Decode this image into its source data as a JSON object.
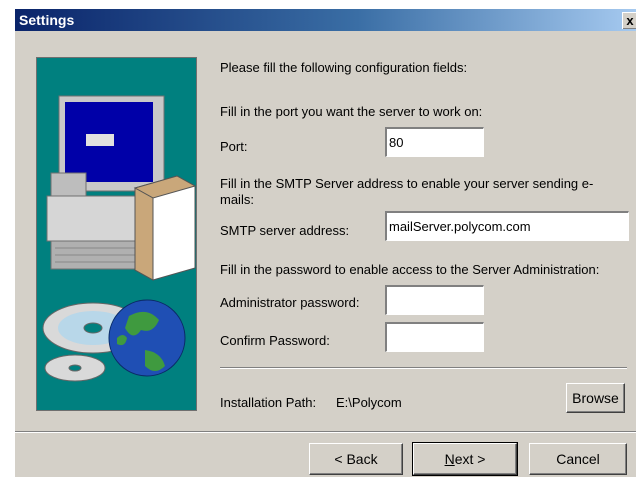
{
  "window": {
    "title": "Settings",
    "close_glyph": "x"
  },
  "intro": {
    "heading": "Please fill the following configuration fields:",
    "port_hint": "Fill in the port you want the server to work on:",
    "smtp_hint": "Fill in the SMTP Server address to enable your server sending e-mails:",
    "password_hint": "Fill in the password to enable access to the Server Administration:"
  },
  "fields": {
    "port": {
      "label": "Port:",
      "value": "80"
    },
    "smtp": {
      "label": "SMTP server address:",
      "value": "mailServer.polycom.com"
    },
    "admin_password": {
      "label": "Administrator password:",
      "value": ""
    },
    "confirm_password": {
      "label": "Confirm Password:",
      "value": ""
    }
  },
  "install": {
    "label": "Installation Path:",
    "path": "E:\\Polycom",
    "browse_label": "Browse"
  },
  "buttons": {
    "back_label": "< Back",
    "next_prefix": "",
    "next_mnemonic": "N",
    "next_suffix": "ext >",
    "cancel_label": "Cancel"
  },
  "illustration": {
    "icons": [
      "computer-icon",
      "cd-icon",
      "globe-icon",
      "box-icon"
    ]
  },
  "colors": {
    "titlebar_start": "#0a246a",
    "titlebar_end": "#a6caf0",
    "illustration_bg": "#00807f",
    "dialog_bg": "#d4d0c8"
  }
}
